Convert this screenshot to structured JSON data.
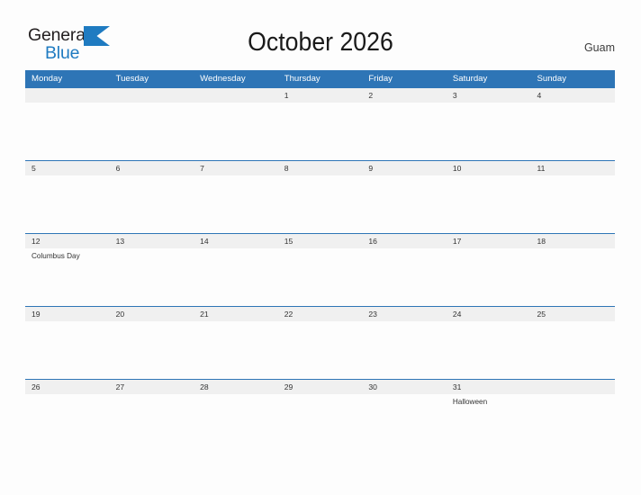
{
  "brand": {
    "name_part1": "General",
    "name_part2": "Blue",
    "flag_icon": "triangle-flag-icon",
    "color_dark": "#231F20",
    "color_blue": "#1F7BC1"
  },
  "header": {
    "title": "October 2026",
    "location": "Guam"
  },
  "theme": {
    "header_blue": "#2E75B6",
    "date_strip_gray": "#F0F0F0",
    "page_background": "#FDFDFD",
    "text_color": "#333333"
  },
  "calendar": {
    "weekdays": [
      "Monday",
      "Tuesday",
      "Wednesday",
      "Thursday",
      "Friday",
      "Saturday",
      "Sunday"
    ],
    "weeks": [
      {
        "days": [
          {
            "date": "",
            "event": ""
          },
          {
            "date": "",
            "event": ""
          },
          {
            "date": "",
            "event": ""
          },
          {
            "date": "1",
            "event": ""
          },
          {
            "date": "2",
            "event": ""
          },
          {
            "date": "3",
            "event": ""
          },
          {
            "date": "4",
            "event": ""
          }
        ]
      },
      {
        "days": [
          {
            "date": "5",
            "event": ""
          },
          {
            "date": "6",
            "event": ""
          },
          {
            "date": "7",
            "event": ""
          },
          {
            "date": "8",
            "event": ""
          },
          {
            "date": "9",
            "event": ""
          },
          {
            "date": "10",
            "event": ""
          },
          {
            "date": "11",
            "event": ""
          }
        ]
      },
      {
        "days": [
          {
            "date": "12",
            "event": "Columbus Day"
          },
          {
            "date": "13",
            "event": ""
          },
          {
            "date": "14",
            "event": ""
          },
          {
            "date": "15",
            "event": ""
          },
          {
            "date": "16",
            "event": ""
          },
          {
            "date": "17",
            "event": ""
          },
          {
            "date": "18",
            "event": ""
          }
        ]
      },
      {
        "days": [
          {
            "date": "19",
            "event": ""
          },
          {
            "date": "20",
            "event": ""
          },
          {
            "date": "21",
            "event": ""
          },
          {
            "date": "22",
            "event": ""
          },
          {
            "date": "23",
            "event": ""
          },
          {
            "date": "24",
            "event": ""
          },
          {
            "date": "25",
            "event": ""
          }
        ]
      },
      {
        "days": [
          {
            "date": "26",
            "event": ""
          },
          {
            "date": "27",
            "event": ""
          },
          {
            "date": "28",
            "event": ""
          },
          {
            "date": "29",
            "event": ""
          },
          {
            "date": "30",
            "event": ""
          },
          {
            "date": "31",
            "event": "Halloween"
          },
          {
            "date": "",
            "event": ""
          }
        ]
      }
    ]
  }
}
